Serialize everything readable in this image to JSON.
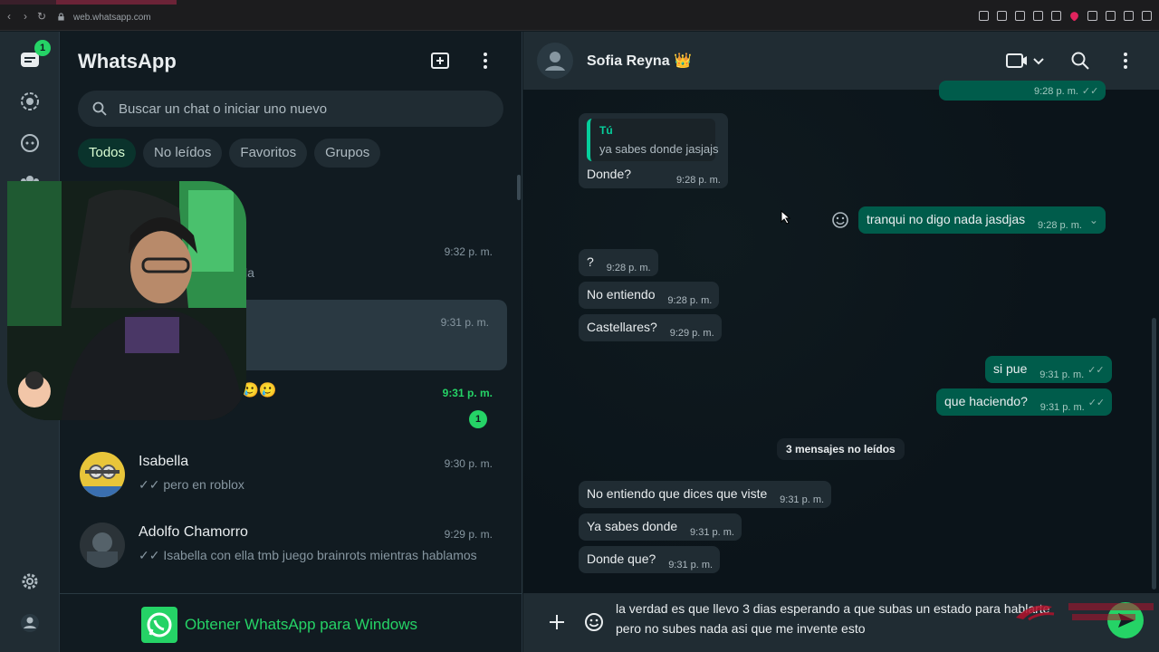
{
  "browser": {
    "url": "web.whatsapp.com"
  },
  "rail": {
    "chats_badge": "1"
  },
  "sidebar": {
    "app_title": "WhatsApp",
    "search_placeholder": "Buscar un chat o iniciar uno nuevo",
    "filters": [
      {
        "label": "Todos",
        "active": true
      },
      {
        "label": "No leídos",
        "active": false
      },
      {
        "label": "Favoritos",
        "active": false
      },
      {
        "label": "Grupos",
        "active": false
      }
    ],
    "chats": [
      {
        "name": "",
        "time": "9:32 p. m.",
        "preview": "la",
        "unread": false
      },
      {
        "name": "",
        "time": "9:31 p. m.",
        "preview": "",
        "unread": false
      },
      {
        "name": "",
        "time": "9:31 p. m.",
        "preview": "🥲🥲",
        "unread": true,
        "unread_count": "1"
      },
      {
        "name": "Isabella",
        "time": "9:30 p. m.",
        "preview": "pero en roblox",
        "ticks": "✓✓",
        "unread": false
      },
      {
        "name": "Adolfo Chamorro",
        "time": "9:29 p. m.",
        "preview": "Isabella con ella tmb juego brainrots mientras hablamos",
        "ticks": "✓✓",
        "unread": false
      }
    ],
    "promo_text": "Obtener WhatsApp para Windows"
  },
  "conversation": {
    "contact_name": "Sofia Reyna 👑",
    "messages": [
      {
        "dir": "out",
        "text": "",
        "time": "9:28 p. m.",
        "ticks": "✓✓"
      },
      {
        "dir": "in",
        "quote_author": "Tú",
        "quote_text": "ya sabes donde jasjajs",
        "text": "Donde?",
        "time": "9:28 p. m."
      },
      {
        "dir": "out",
        "text": "tranqui no digo nada jasdjas",
        "time": "9:28 p. m."
      },
      {
        "dir": "in",
        "text": "?",
        "time": "9:28 p. m."
      },
      {
        "dir": "in",
        "text": "No entiendo",
        "time": "9:28 p. m."
      },
      {
        "dir": "in",
        "text": "Castellares?",
        "time": "9:29 p. m."
      },
      {
        "dir": "out",
        "text": "si pue",
        "time": "9:31 p. m.",
        "ticks": "✓✓"
      },
      {
        "dir": "out",
        "text": "que haciendo?",
        "time": "9:31 p. m.",
        "ticks": "✓✓"
      },
      {
        "dir": "in",
        "text": "No entiendo que dices que viste",
        "time": "9:31 p. m."
      },
      {
        "dir": "in",
        "text": "Ya sabes donde",
        "time": "9:31 p. m."
      },
      {
        "dir": "in",
        "text": "Donde que?",
        "time": "9:31 p. m."
      }
    ],
    "unread_separator": "3 mensajes no leídos",
    "composer_line1": "la verdad es que llevo 3 dias esperando a que subas un estado para hablarte",
    "composer_line2": "pero no subes nada asi que me invente esto"
  },
  "colors": {
    "accent": "#25d366",
    "outgoing_bubble": "#005c4b",
    "incoming_bubble": "#202c33",
    "panel": "#111b21"
  }
}
